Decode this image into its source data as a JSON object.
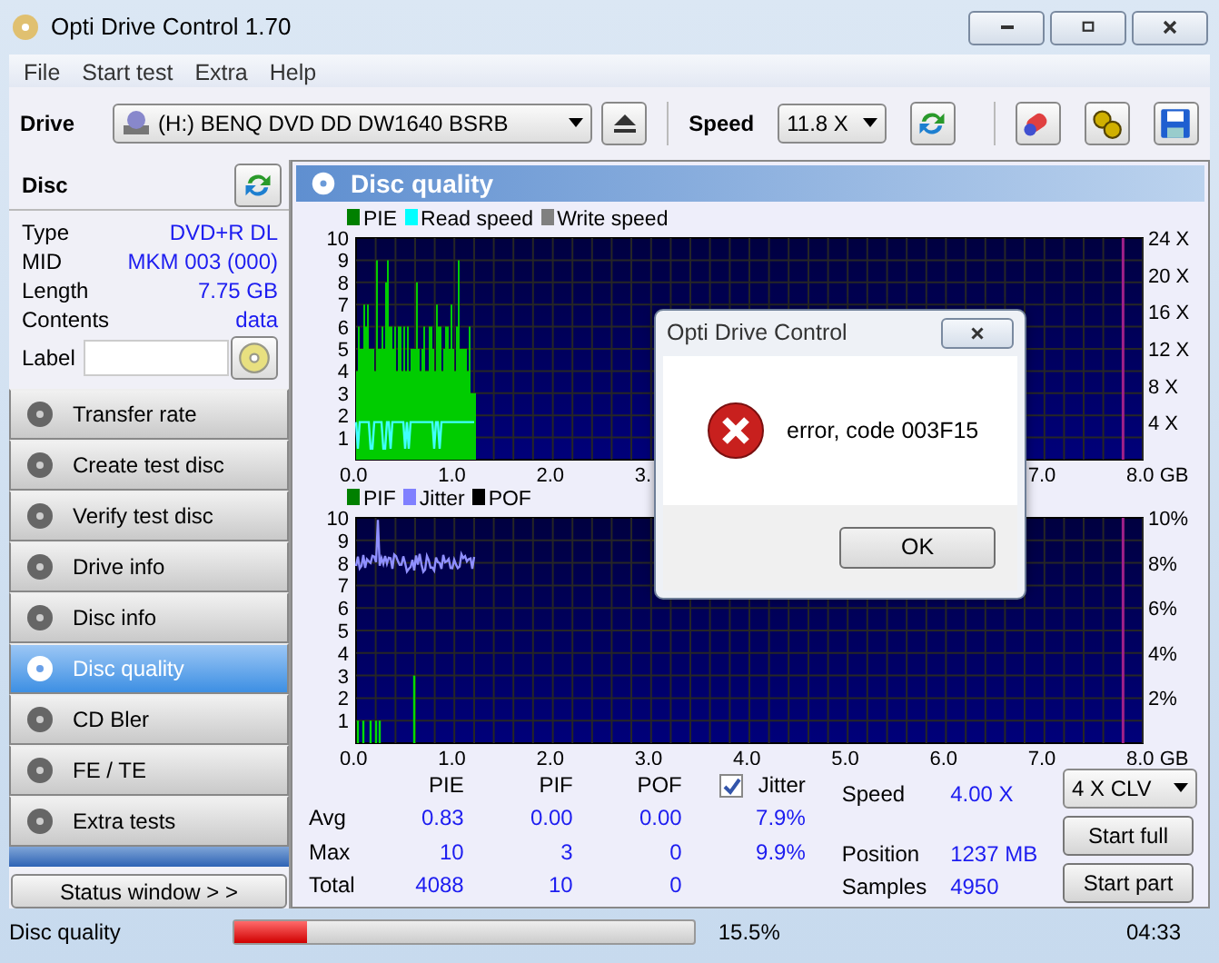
{
  "window": {
    "title": "Opti Drive Control 1.70"
  },
  "menu": [
    "File",
    "Start test",
    "Extra",
    "Help"
  ],
  "toolbar": {
    "drive_label": "Drive",
    "drive": "(H:)   BENQ DVD DD DW1640 BSRB",
    "speed_label": "Speed",
    "speed": "11.8 X"
  },
  "disc": {
    "title": "Disc",
    "fields": [
      {
        "label": "Type",
        "value": "DVD+R DL"
      },
      {
        "label": "MID",
        "value": "MKM 003 (000)"
      },
      {
        "label": "Length",
        "value": "7.75 GB"
      },
      {
        "label": "Contents",
        "value": "data"
      }
    ],
    "label_field": "Label"
  },
  "nav": [
    {
      "label": "Transfer rate",
      "selected": false
    },
    {
      "label": "Create test disc",
      "selected": false
    },
    {
      "label": "Verify test disc",
      "selected": false
    },
    {
      "label": "Drive info",
      "selected": false
    },
    {
      "label": "Disc info",
      "selected": false
    },
    {
      "label": "Disc quality",
      "selected": true
    },
    {
      "label": "CD Bler",
      "selected": false
    },
    {
      "label": "FE / TE",
      "selected": false
    },
    {
      "label": "Extra tests",
      "selected": false
    }
  ],
  "status_window_button": "Status window > >",
  "panel_title": "Disc quality",
  "charts": [
    {
      "kind": "pie-speed",
      "legend": [
        {
          "label": "PIE",
          "color": "#008000"
        },
        {
          "label": "Read speed",
          "color": "#00ffff"
        },
        {
          "label": "Write speed",
          "color": "#808080"
        }
      ],
      "y_ticks": [
        "10",
        "9",
        "8",
        "7",
        "6",
        "5",
        "4",
        "3",
        "2",
        "1"
      ],
      "y2_ticks": [
        "24 X",
        "20 X",
        "16 X",
        "12 X",
        "8 X",
        "4 X"
      ],
      "x_ticks": [
        "0.0",
        "1.0",
        "2.0",
        "3.",
        "7.0",
        "8.0 GB"
      ]
    },
    {
      "kind": "pif-jitter",
      "legend": [
        {
          "label": "PIF",
          "color": "#008000"
        },
        {
          "label": "Jitter",
          "color": "#8080ff"
        },
        {
          "label": "POF",
          "color": "#000000"
        }
      ],
      "y_ticks": [
        "10",
        "9",
        "8",
        "7",
        "6",
        "5",
        "4",
        "3",
        "2",
        "1"
      ],
      "y2_ticks": [
        "10%",
        "8%",
        "6%",
        "4%",
        "2%"
      ],
      "x_ticks": [
        "0.0",
        "1.0",
        "2.0",
        "3.0",
        "4.0",
        "5.0",
        "6.0",
        "7.0",
        "8.0 GB"
      ]
    }
  ],
  "stats": {
    "columns": [
      "PIE",
      "PIF",
      "POF"
    ],
    "jitter": {
      "label": "Jitter",
      "checked": true
    },
    "rows": [
      {
        "label": "Avg",
        "values": [
          "0.83",
          "0.00",
          "0.00"
        ],
        "jitter": "7.9%"
      },
      {
        "label": "Max",
        "values": [
          "10",
          "3",
          "0"
        ],
        "jitter": "9.9%"
      },
      {
        "label": "Total",
        "values": [
          "4088",
          "10",
          "0"
        ]
      }
    ],
    "info": [
      {
        "label": "Speed",
        "value": "4.00 X"
      },
      {
        "label": "Position",
        "value": "1237 MB"
      },
      {
        "label": "Samples",
        "value": "4950"
      }
    ],
    "speed_select": "4 X CLV",
    "buttons": [
      "Start full",
      "Start part"
    ]
  },
  "status_bar": {
    "mode": "Disc quality",
    "progress": {
      "level": 0.155
    },
    "percent": "15.5%",
    "time": "04:33"
  },
  "dialog": {
    "title": "Opti Drive Control",
    "message": "error, code 003F15",
    "button": "OK"
  }
}
